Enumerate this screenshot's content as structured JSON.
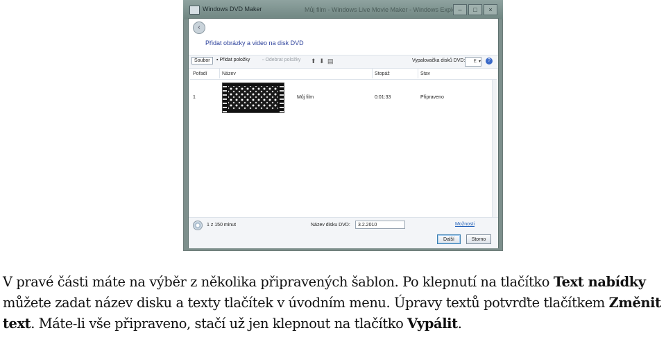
{
  "screenshot": {
    "window_title": "Windows DVD Maker",
    "background_window_text": "Můj film - Windows Live Movie Maker - Windows Explorer",
    "heading": "Přidat obrázky a video na disk DVD",
    "toolbar": {
      "file": "Soubor",
      "add_items": "Přidat položky",
      "remove_items": "Odebrat položky",
      "burner_label": "Vypalovačka disků DVD:",
      "burner_value": "E:"
    },
    "columns": [
      "Pořadí",
      "Název",
      "Stopáž",
      "Stav"
    ],
    "rows": [
      {
        "order": "1",
        "name": "Můj film",
        "duration": "0:01:33",
        "status": "Připraveno"
      }
    ],
    "footer": {
      "duration_info": "1 z 150 minut",
      "disc_name_label": "Název disku DVD:",
      "disc_name_value": "3.2.2010",
      "options": "Možnosti",
      "next": "Další",
      "cancel": "Storno"
    }
  },
  "paragraph": {
    "s1": "V pravé části máte na výběr z několika připravených šablon. Po klepnutí na tlačítko ",
    "b1": "Text nabídky",
    "s2": " můžete zadat název disku a texty tlačítek v úvodním menu. Úpravy textů potvrďte tlačítkem ",
    "b2": "Změnit text",
    "s3": ". Máte-li vše připraveno, stačí už jen klepnout na tlačítko ",
    "b3": "Vypálit",
    "s4": "."
  }
}
